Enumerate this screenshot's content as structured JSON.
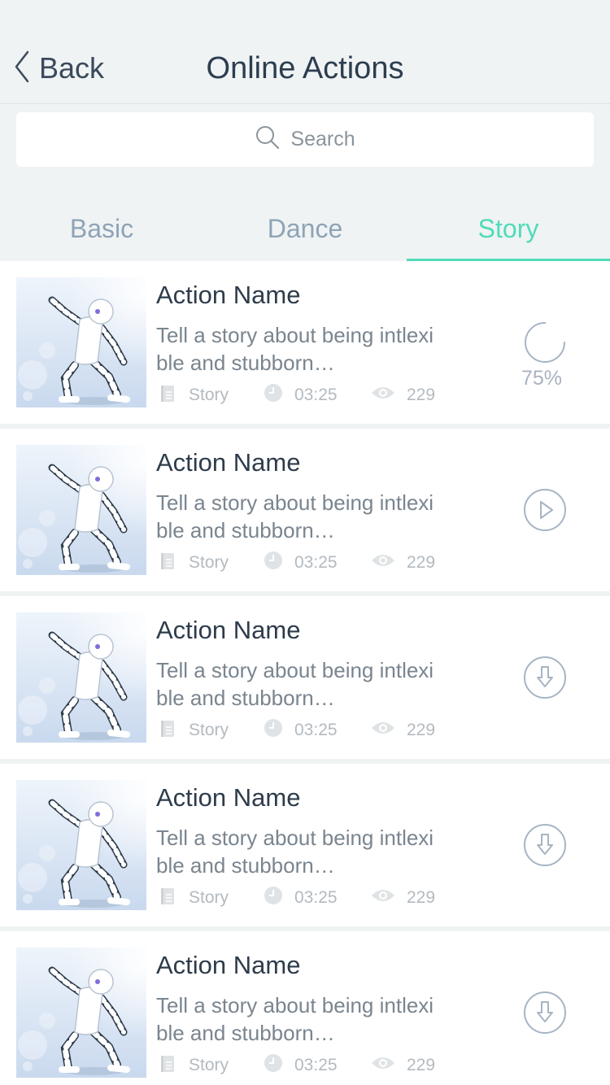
{
  "nav": {
    "back_label": "Back",
    "title": "Online Actions"
  },
  "search": {
    "icon": "search-icon",
    "placeholder": "Search"
  },
  "tabs": [
    {
      "label": "Basic",
      "active": false
    },
    {
      "label": "Dance",
      "active": false
    },
    {
      "label": "Story",
      "active": true
    }
  ],
  "colors": {
    "accent": "#50dbb8",
    "tab_inactive": "#8fa3b6",
    "background": "#eff3f4",
    "action_icon": "#a7b4c4"
  },
  "items": [
    {
      "name": "Action Name",
      "description": "Tell a story about being intlexi ble and stubborn…",
      "category": "Story",
      "duration": "03:25",
      "views": "229",
      "action": "progress",
      "progress_label": "75%",
      "progress": 0.75
    },
    {
      "name": "Action Name",
      "description": "Tell a story about being intlexi ble and stubborn…",
      "category": "Story",
      "duration": "03:25",
      "views": "229",
      "action": "play"
    },
    {
      "name": "Action Name",
      "description": "Tell a story about being intlexi ble and stubborn…",
      "category": "Story",
      "duration": "03:25",
      "views": "229",
      "action": "download"
    },
    {
      "name": "Action Name",
      "description": "Tell a story about being intlexi ble and stubborn…",
      "category": "Story",
      "duration": "03:25",
      "views": "229",
      "action": "download"
    },
    {
      "name": "Action Name",
      "description": "Tell a story about being intlexi ble and stubborn…",
      "category": "Story",
      "duration": "03:25",
      "views": "229",
      "action": "download"
    }
  ]
}
